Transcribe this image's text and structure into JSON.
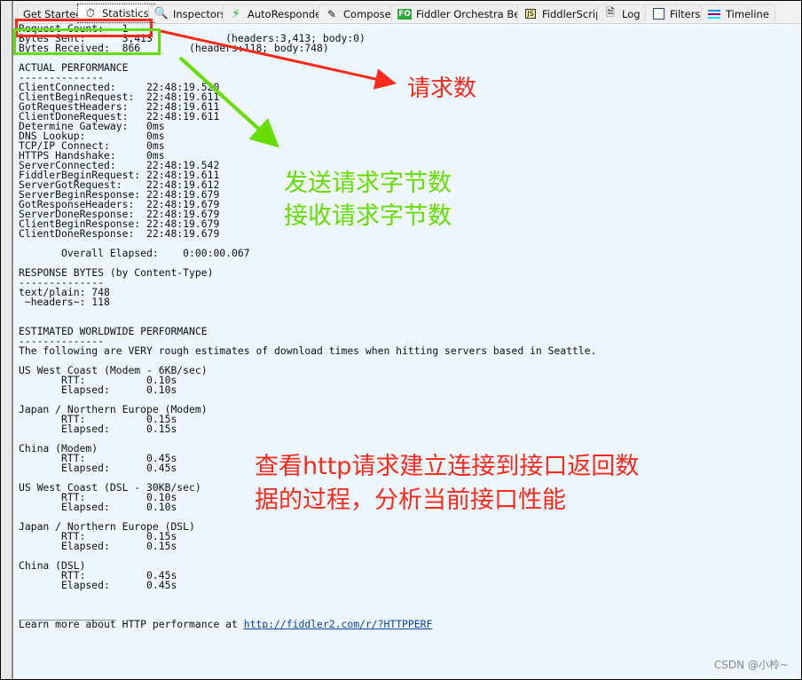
{
  "tabs": [
    {
      "label": "Get Started",
      "icon": "none"
    },
    {
      "label": "Statistics",
      "icon": "stopwatch-icon",
      "active": true
    },
    {
      "label": "Inspectors",
      "icon": "magnifier-icon"
    },
    {
      "label": "AutoResponder",
      "icon": "lightning-icon"
    },
    {
      "label": "Composer",
      "icon": "pencil-icon"
    },
    {
      "label": "Fiddler Orchestra Beta",
      "icon": "fo-icon",
      "badge": "FO"
    },
    {
      "label": "FiddlerScript",
      "icon": "script-icon",
      "badge": "JS"
    },
    {
      "label": "Log",
      "icon": "document-icon"
    },
    {
      "label": "Filters",
      "icon": "checkbox-icon"
    },
    {
      "label": "Timeline",
      "icon": "timeline-icon"
    }
  ],
  "stats_lines": [
    "Request Count:   1",
    "Bytes Sent:      3,413            (headers:3,413; body:0)",
    "Bytes Received:  866        (headers:118; body:748)",
    "",
    "ACTUAL PERFORMANCE",
    "--------------",
    "ClientConnected:     22:48:19.520",
    "ClientBeginRequest:  22:48:19.611",
    "GotRequestHeaders:   22:48:19.611",
    "ClientDoneRequest:   22:48:19.611",
    "Determine Gateway:   0ms",
    "DNS Lookup:          0ms",
    "TCP/IP Connect:      0ms",
    "HTTPS Handshake:     0ms",
    "ServerConnected:     22:48:19.542",
    "FiddlerBeginRequest: 22:48:19.611",
    "ServerGotRequest:    22:48:19.612",
    "ServerBeginResponse: 22:48:19.679",
    "GotResponseHeaders:  22:48:19.679",
    "ServerDoneResponse:  22:48:19.679",
    "ClientBeginResponse: 22:48:19.679",
    "ClientDoneResponse:  22:48:19.679",
    "",
    "       Overall Elapsed:    0:00:00.067",
    "",
    "RESPONSE BYTES (by Content-Type)",
    "--------------",
    "text/plain: 748",
    " ~headers~: 118",
    "",
    "",
    "ESTIMATED WORLDWIDE PERFORMANCE",
    "--------------",
    "The following are VERY rough estimates of download times when hitting servers based in Seattle.",
    "",
    "US West Coast (Modem - 6KB/sec)",
    "       RTT:          0.10s",
    "       Elapsed:      0.10s",
    "",
    "Japan / Northern Europe (Modem)",
    "       RTT:          0.15s",
    "       Elapsed:      0.15s",
    "",
    "China (Modem)",
    "       RTT:          0.45s",
    "       Elapsed:      0.45s",
    "",
    "US West Coast (DSL - 30KB/sec)",
    "       RTT:          0.10s",
    "       Elapsed:      0.10s",
    "",
    "Japan / Northern Europe (DSL)",
    "       RTT:          0.15s",
    "       Elapsed:      0.15s",
    "",
    "China (DSL)",
    "       RTT:          0.45s",
    "       Elapsed:      0.45s",
    "",
    "",
    "________________"
  ],
  "footer": {
    "text": "Learn more about HTTP performance at ",
    "link": "http://fiddler2.com/r/?HTTPPERF"
  },
  "annotations": {
    "request_count": "请求数",
    "bytes_sent": "发送请求字节数",
    "bytes_received": "接收请求字节数",
    "summary_line1": "查看http请求建立连接到接口返回数",
    "summary_line2": "据的过程，分析当前接口性能",
    "red": "#ff2a1a",
    "green": "#66dd00"
  },
  "watermark": "CSDN @小柃~"
}
